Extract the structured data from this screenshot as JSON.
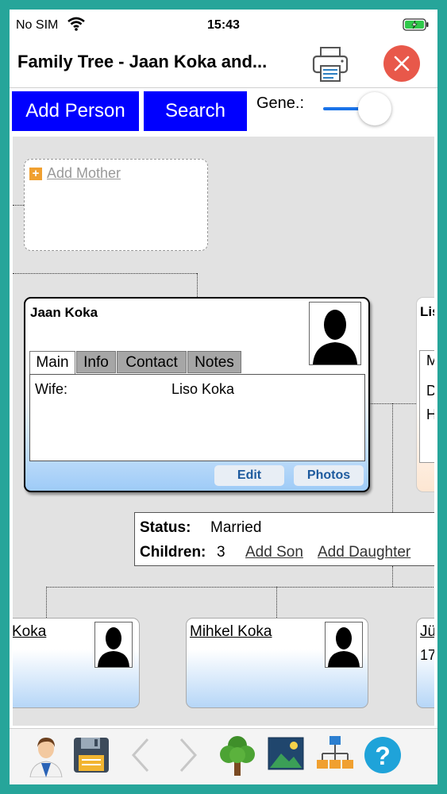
{
  "status_bar": {
    "carrier": "No SIM",
    "time": "15:43"
  },
  "header": {
    "title": "Family Tree - Jaan Koka and..."
  },
  "toolbar": {
    "add_person": "Add Person",
    "search": "Search",
    "generations_label": "Gene.:"
  },
  "tree": {
    "add_mother": "Add Mother",
    "person": {
      "name": "Jaan Koka",
      "tabs": [
        "Main",
        "Info",
        "Contact",
        "Notes"
      ],
      "relation_label": "Wife:",
      "relation_value": "Liso Koka",
      "edit_label": "Edit",
      "photos_label": "Photos"
    },
    "spouse_card": {
      "name_fragment": "Lis",
      "tab_fragment": "M",
      "rows": [
        "D",
        "H"
      ]
    },
    "marriage": {
      "status_label": "Status:",
      "status_value": "Married",
      "children_label": "Children:",
      "children_count": "3",
      "add_son": "Add Son",
      "add_daughter": "Add Daughter"
    },
    "children": [
      {
        "name": "Koka"
      },
      {
        "name": "Mihkel Koka"
      },
      {
        "name": "Jü",
        "detail": "17"
      }
    ]
  },
  "colors": {
    "accent_blue": "#0000ff",
    "close_red": "#e8584a",
    "frame_teal": "#26a59a",
    "help_blue": "#1fa3d9"
  },
  "bottom_bar": {
    "icons": [
      "person-icon",
      "save-icon",
      "back-arrow-icon",
      "forward-arrow-icon",
      "tree-icon",
      "image-icon",
      "hierarchy-icon",
      "help-icon"
    ]
  }
}
